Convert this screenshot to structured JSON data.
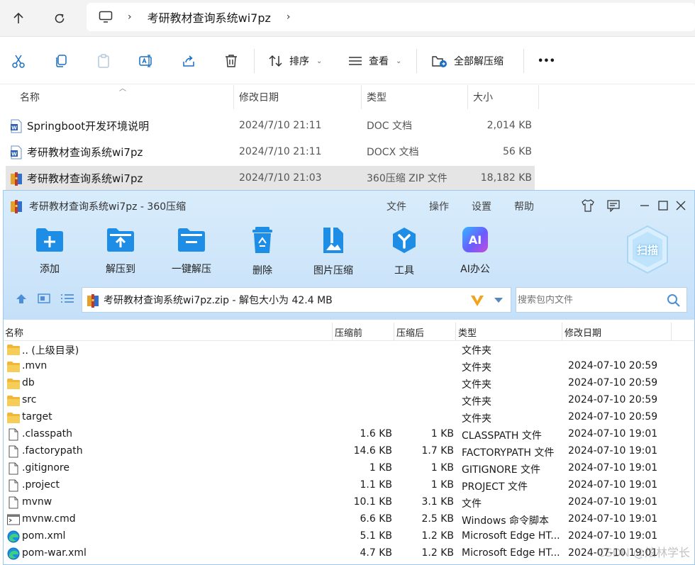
{
  "explorer": {
    "address": {
      "breadcrumb": "考研教材查询系统wi7pz"
    },
    "commands": {
      "sort_label": "排序",
      "view_label": "查看",
      "extract_all_label": "全部解压缩",
      "more_label": "•••"
    },
    "columns": {
      "name": "名称",
      "modified": "修改日期",
      "type": "类型",
      "size": "大小"
    },
    "files": [
      {
        "name": "Springboot开发环境说明",
        "modified": "2024/7/10 21:11",
        "type": "DOC 文档",
        "size": "2,014 KB",
        "icon": "word-doc-icon"
      },
      {
        "name": "考研教材查询系统wi7pz",
        "modified": "2024/7/10 21:11",
        "type": "DOCX 文档",
        "size": "56 KB",
        "icon": "word-doc-icon"
      },
      {
        "name": "考研教材查询系统wi7pz",
        "modified": "2024/7/10 21:03",
        "type": "360压缩 ZIP 文件",
        "size": "18,182 KB",
        "icon": "zip-archive-icon",
        "selected": true
      }
    ]
  },
  "zip": {
    "title": "考研教材查询系统wi7pz - 360压缩",
    "menu": [
      "文件",
      "操作",
      "设置",
      "帮助"
    ],
    "toolbar": [
      {
        "label": "添加",
        "icon": "add-folder-icon"
      },
      {
        "label": "解压到",
        "icon": "extract-to-icon"
      },
      {
        "label": "一键解压",
        "icon": "one-click-extract-icon"
      },
      {
        "label": "删除",
        "icon": "recycle-delete-icon"
      },
      {
        "label": "图片压缩",
        "icon": "image-compress-icon"
      },
      {
        "label": "工具",
        "icon": "tools-icon"
      },
      {
        "label": "AI办公",
        "icon": "ai-office-icon"
      }
    ],
    "scan_label": "扫描",
    "ai_badge": "AI",
    "path_text": "考研教材查询系统wi7pz.zip - 解包大小为 42.4 MB",
    "search_placeholder": "搜索包内文件",
    "columns": {
      "name": "名称",
      "before": "压缩前",
      "after": "压缩后",
      "type": "类型",
      "modified": "修改日期"
    },
    "entries": [
      {
        "name": ".. (上级目录)",
        "before": "",
        "after": "",
        "type": "文件夹",
        "modified": "",
        "icon": "folder-icon"
      },
      {
        "name": ".mvn",
        "before": "",
        "after": "",
        "type": "文件夹",
        "modified": "2024-07-10 20:59",
        "icon": "folder-icon"
      },
      {
        "name": "db",
        "before": "",
        "after": "",
        "type": "文件夹",
        "modified": "2024-07-10 20:59",
        "icon": "folder-icon"
      },
      {
        "name": "src",
        "before": "",
        "after": "",
        "type": "文件夹",
        "modified": "2024-07-10 20:59",
        "icon": "folder-icon"
      },
      {
        "name": "target",
        "before": "",
        "after": "",
        "type": "文件夹",
        "modified": "2024-07-10 20:59",
        "icon": "folder-icon"
      },
      {
        "name": ".classpath",
        "before": "1.6 KB",
        "after": "1 KB",
        "type": "CLASSPATH 文件",
        "modified": "2024-07-10 19:01",
        "icon": "file-icon"
      },
      {
        "name": ".factorypath",
        "before": "14.6 KB",
        "after": "1.7 KB",
        "type": "FACTORYPATH 文件",
        "modified": "2024-07-10 19:01",
        "icon": "file-icon"
      },
      {
        "name": ".gitignore",
        "before": "1 KB",
        "after": "1 KB",
        "type": "GITIGNORE 文件",
        "modified": "2024-07-10 19:01",
        "icon": "file-icon"
      },
      {
        "name": ".project",
        "before": "1.1 KB",
        "after": "1 KB",
        "type": "PROJECT 文件",
        "modified": "2024-07-10 19:01",
        "icon": "file-icon"
      },
      {
        "name": "mvnw",
        "before": "10.1 KB",
        "after": "3.1 KB",
        "type": "文件",
        "modified": "2024-07-10 19:01",
        "icon": "file-icon"
      },
      {
        "name": "mvnw.cmd",
        "before": "6.6 KB",
        "after": "2.5 KB",
        "type": "Windows 命令脚本",
        "modified": "2024-07-10 19:01",
        "icon": "cmd-script-icon"
      },
      {
        "name": "pom.xml",
        "before": "5.1 KB",
        "after": "1.2 KB",
        "type": "Microsoft Edge HT...",
        "modified": "2024-07-10 19:01",
        "icon": "edge-icon"
      },
      {
        "name": "pom-war.xml",
        "before": "4.7 KB",
        "after": "1.2 KB",
        "type": "Microsoft Edge HT...",
        "modified": "2024-07-10 19:01",
        "icon": "edge-icon"
      }
    ]
  },
  "watermark": "CSDN @炫林学长",
  "colors": {
    "accent_blue": "#1a8fe3",
    "zip_header_bg": "#d3e9fb",
    "selection": "#e5e5e5",
    "folder": "#f5c242"
  }
}
